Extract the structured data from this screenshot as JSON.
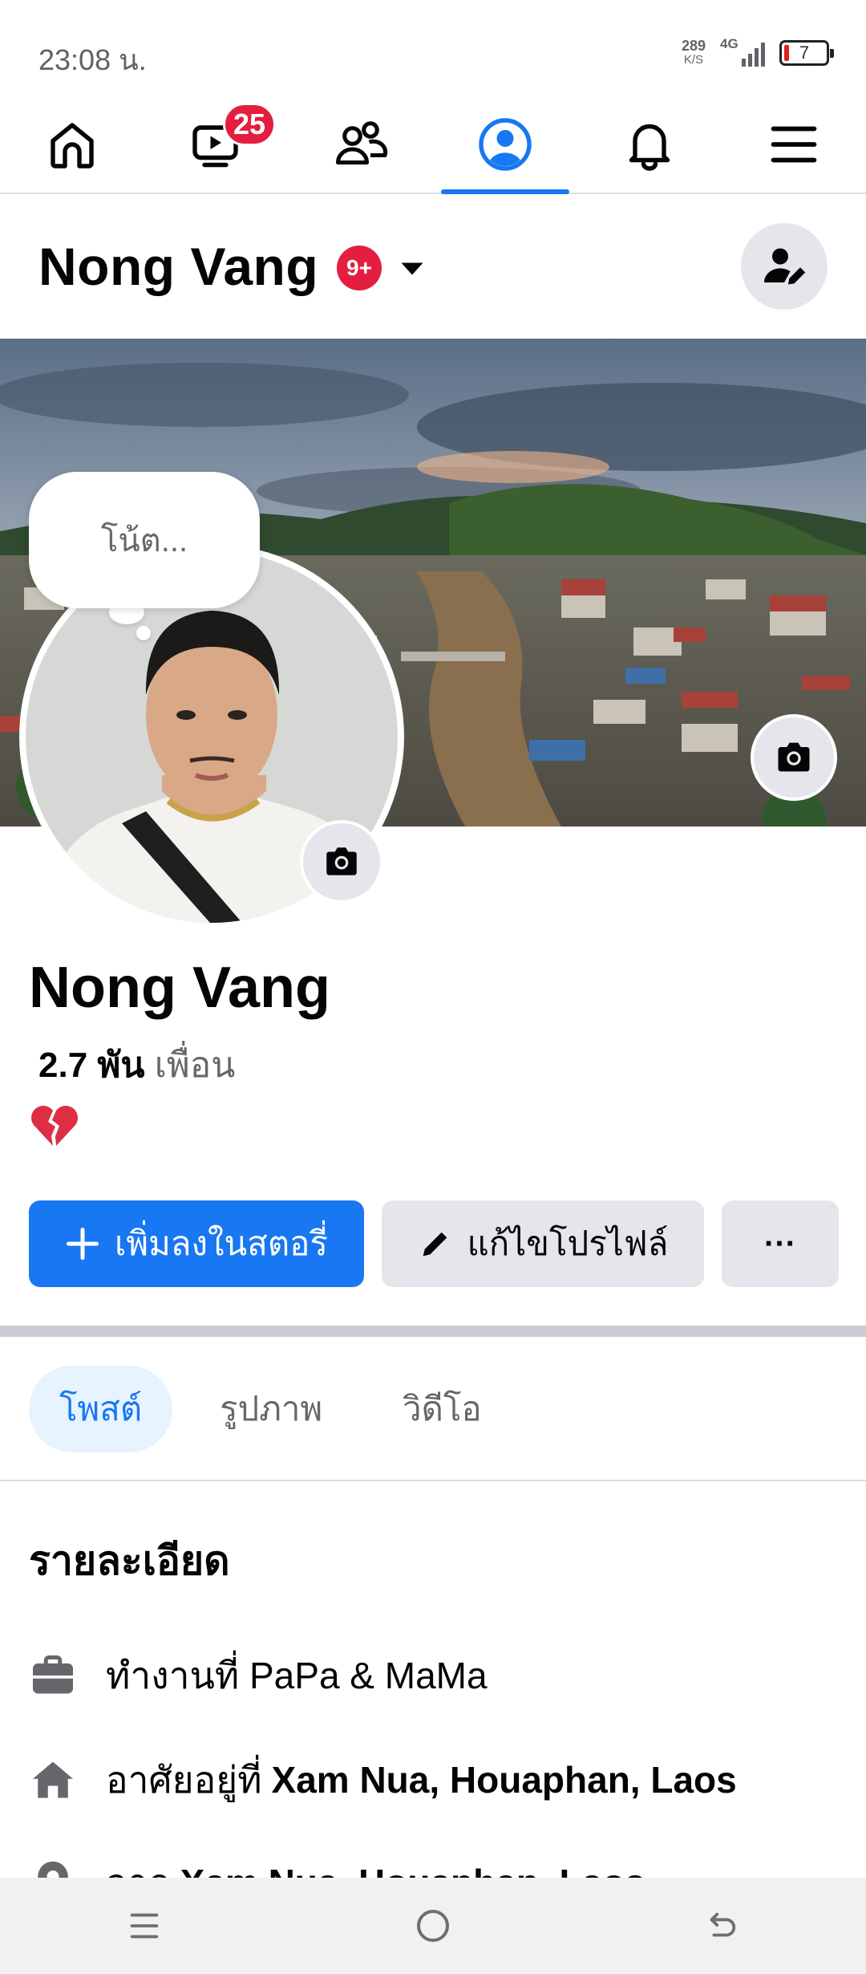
{
  "status_bar": {
    "time": "23:08 น.",
    "net_speed_value": "289",
    "net_speed_unit": "K/S",
    "network": "4G",
    "battery": "7"
  },
  "top_nav": {
    "items": [
      {
        "name": "home",
        "icon": "home-icon"
      },
      {
        "name": "video",
        "icon": "video-icon",
        "badge": "25"
      },
      {
        "name": "friends",
        "icon": "friends-icon"
      },
      {
        "name": "profile",
        "icon": "profile-icon",
        "active": true
      },
      {
        "name": "notifications",
        "icon": "bell-icon"
      },
      {
        "name": "menu",
        "icon": "menu-icon"
      }
    ],
    "active_color": "#1877f2"
  },
  "header": {
    "name": "Nong Vang",
    "badge": "9+"
  },
  "note": {
    "placeholder": "โน้ต..."
  },
  "profile": {
    "name": "Nong Vang",
    "friends_count": "2.7 พัน",
    "friends_label": "เพื่อน",
    "bio_emoji": "broken-heart-icon"
  },
  "actions": {
    "add_story": "เพิ่มลงในสตอรี่",
    "edit_profile": "แก้ไขโปรไฟล์",
    "more": "···"
  },
  "tabs": [
    {
      "label": "โพสต์",
      "active": true
    },
    {
      "label": "รูปภาพ"
    },
    {
      "label": "วิดีโอ"
    }
  ],
  "details": {
    "title": "รายละเอียด",
    "work": {
      "prefix": "ทำงานที่ PaPa & MaMa",
      "icon": "briefcase-icon"
    },
    "lives": {
      "prefix": "อาศัยอยู่ที่",
      "place": "Xam Nua, Houaphan, Laos",
      "icon": "house-icon"
    },
    "from": {
      "prefix": "จาก",
      "place": "Xam Nua, Houaphan, Laos",
      "icon": "location-pin-icon"
    }
  },
  "colors": {
    "brand_blue": "#1877f2",
    "badge_red": "#e41e3f",
    "secondary_button": "#e4e6eb"
  }
}
